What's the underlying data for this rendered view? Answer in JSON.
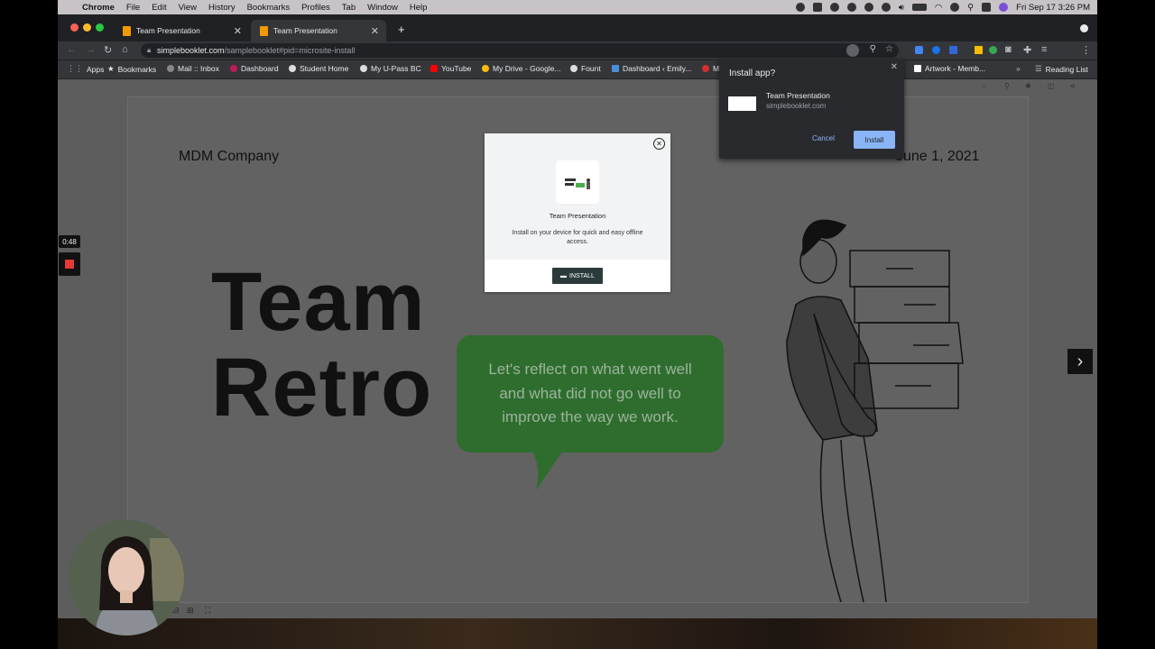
{
  "menubar": {
    "app": "Chrome",
    "items": [
      "File",
      "Edit",
      "View",
      "History",
      "Bookmarks",
      "Profiles",
      "Tab",
      "Window",
      "Help"
    ],
    "datetime": "Fri Sep 17  3:26 PM"
  },
  "tabs": [
    {
      "label": "Team Presentation"
    },
    {
      "label": "Team Presentation"
    }
  ],
  "omnibox": {
    "host": "simplebooklet.com",
    "path": "/samplebooklet#pid=microsite-install"
  },
  "bookmarks": [
    "Apps",
    "Bookmarks",
    "Mail :: Inbox",
    "Dashboard",
    "Student Home",
    "My U-Pass BC",
    "YouTube",
    "My Drive - Google...",
    "Fount",
    "Dashboard ‹ Emily...",
    "Artwork - Memb...",
    "Reading List"
  ],
  "slide": {
    "company": "MDM Company",
    "date": "June 1, 2021",
    "title_line1": "Team",
    "title_line2": "Retro",
    "bubble": "Let's reflect on what went well and what did not go well to improve the way we work."
  },
  "recorder": {
    "timer": "0:48"
  },
  "modal": {
    "title": "Team Presentation",
    "description": "Install on your device for quick and easy offline access.",
    "button": "INSTALL"
  },
  "popup": {
    "title": "Install app?",
    "app_name": "Team Presentation",
    "app_url": "simplebooklet.com",
    "cancel": "Cancel",
    "install": "Install"
  },
  "colors": {
    "bubble_green": "#2f6d2f",
    "install_blue": "#8ab4f8",
    "chrome_dark": "#202124"
  }
}
